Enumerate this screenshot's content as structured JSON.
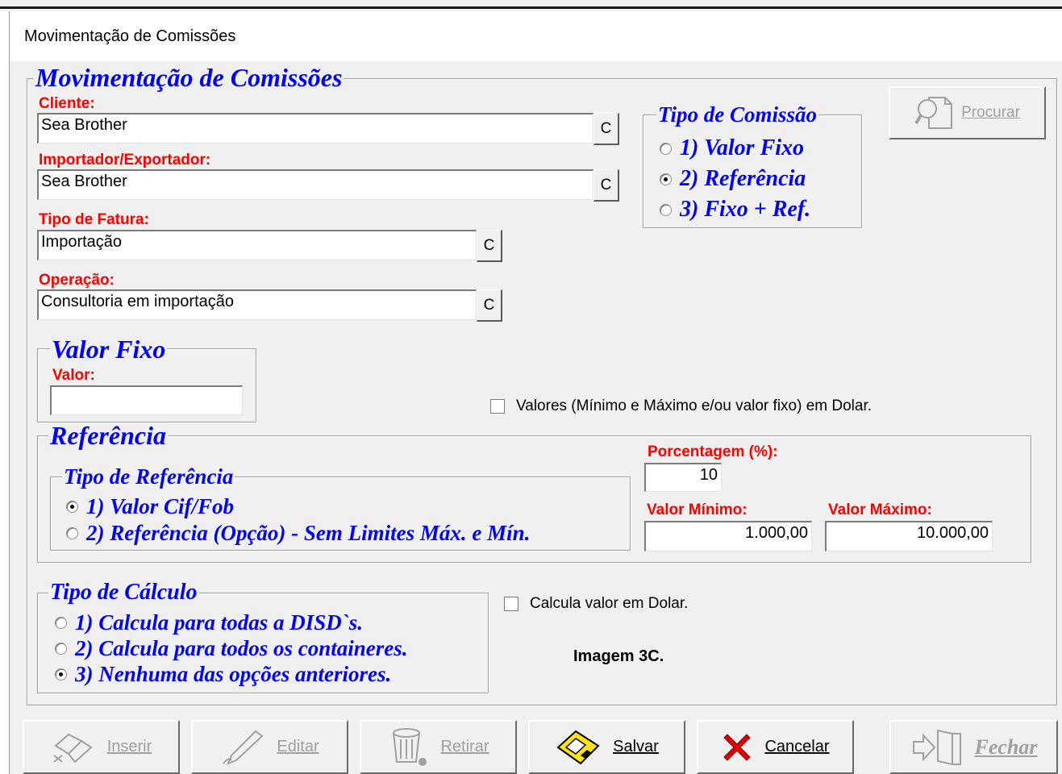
{
  "window": {
    "title": "Movimentação de Comissões"
  },
  "main": {
    "group_title": "Movimentação de Comissões",
    "cliente": {
      "label": "Cliente:",
      "value": "Sea Brother",
      "button": "C"
    },
    "importador": {
      "label": "Importador/Exportador:",
      "value": "Sea Brother",
      "button": "C"
    },
    "tipo_fatura": {
      "label": "Tipo de Fatura:",
      "value": "Importação",
      "button": "C"
    },
    "operacao": {
      "label": "Operação:",
      "value": "Consultoria em importação",
      "button": "C"
    }
  },
  "tipo_comissao": {
    "title": "Tipo de Comissão",
    "options": [
      "1) Valor Fixo",
      "2) Referência",
      "3) Fixo + Ref."
    ],
    "selected": 1
  },
  "procurar": {
    "label": "Procurar",
    "icon": "search-document-icon"
  },
  "valor_fixo": {
    "title": "Valor Fixo",
    "label": "Valor:",
    "value": ""
  },
  "dolar_check": {
    "label": "Valores (Mínimo e Máximo e/ou valor fixo) em Dolar.",
    "checked": false
  },
  "referencia": {
    "title": "Referência",
    "tipo_title": "Tipo de Referência",
    "options": [
      "1) Valor Cif/Fob",
      "2) Referência (Opção) - Sem Limites Máx. e Mín."
    ],
    "selected": 0,
    "porcentagem_label": "Porcentagem (%):",
    "porcentagem_value": "10",
    "minimo_label": "Valor Mínimo:",
    "minimo_value": "1.000,00",
    "maximo_label": "Valor Máximo:",
    "maximo_value": "10.000,00"
  },
  "tipo_calculo": {
    "title": "Tipo de Cálculo",
    "options": [
      "1) Calcula para todas a DISD`s.",
      "2) Calcula para todos os containeres.",
      "3) Nenhuma das opções anteriores."
    ],
    "selected": 2
  },
  "dolar_calc_check": {
    "label": "Calcula valor em Dolar.",
    "checked": false
  },
  "note": "Imagem 3C.",
  "toolbar": {
    "inserir": "Inserir",
    "editar": "Editar",
    "retirar": "Retirar",
    "salvar": "Salvar",
    "cancelar": "Cancelar",
    "fechar": "Fechar"
  }
}
